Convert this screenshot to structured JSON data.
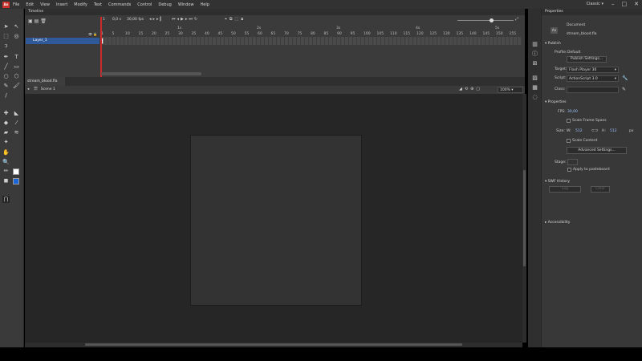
{
  "menubar": {
    "logo": "An",
    "items": [
      "File",
      "Edit",
      "View",
      "Insert",
      "Modify",
      "Text",
      "Commands",
      "Control",
      "Debug",
      "Window",
      "Help"
    ],
    "workspace": "Classic"
  },
  "timeline": {
    "title": "Timeline",
    "fps": "30,00 fps",
    "frame": "1",
    "frame_unit": "0,0 s",
    "ruler_labels": [
      "1",
      "5",
      "10",
      "15",
      "20",
      "25",
      "30",
      "35",
      "40",
      "45",
      "50",
      "55",
      "60",
      "65",
      "70",
      "75",
      "80",
      "85",
      "90",
      "95",
      "100",
      "105",
      "110",
      "115",
      "120",
      "125",
      "130",
      "135",
      "140",
      "145",
      "150",
      "155"
    ],
    "seconds_labels": [
      "1s",
      "2s",
      "3s",
      "4s",
      "5s"
    ],
    "layer_name": "Layer_1"
  },
  "document": {
    "tab_name": "stream_blood.fla",
    "scene": "Scene 1",
    "zoom": "100%"
  },
  "properties": {
    "panel_title": "Properties",
    "doc_type": "Document",
    "doc_name": "stream_blood.fla",
    "publish_section": "Publish",
    "profile_label": "Profile:",
    "profile_value": "Default",
    "publish_settings_btn": "Publish Settings...",
    "target_label": "Target:",
    "target_value": "Flash Player 30",
    "script_label": "Script:",
    "script_value": "ActionScript 3.0",
    "class_label": "Class:",
    "properties_section": "Properties",
    "fps_label": "FPS:",
    "fps_value": "30,00",
    "scale_frame_spans": "Scale Frame Spans",
    "size_label": "Size:",
    "w_label": "W:",
    "w_value": "512",
    "h_label": "H:",
    "h_value": "512",
    "unit": "px",
    "scale_content": "Scale Content",
    "advanced_settings_btn": "Advanced Settings...",
    "stage_label": "Stage:",
    "apply_pasteboard": "Apply to pasteboard",
    "swf_history": "SWF History",
    "swf_log_btn": "Log",
    "swf_clear_btn": "Clear",
    "accessibility": "Accessibility"
  },
  "colors": {
    "accent": "#30599a",
    "playhead": "#d02b2b",
    "stage": "#333333",
    "pasteboard": "#262626"
  }
}
